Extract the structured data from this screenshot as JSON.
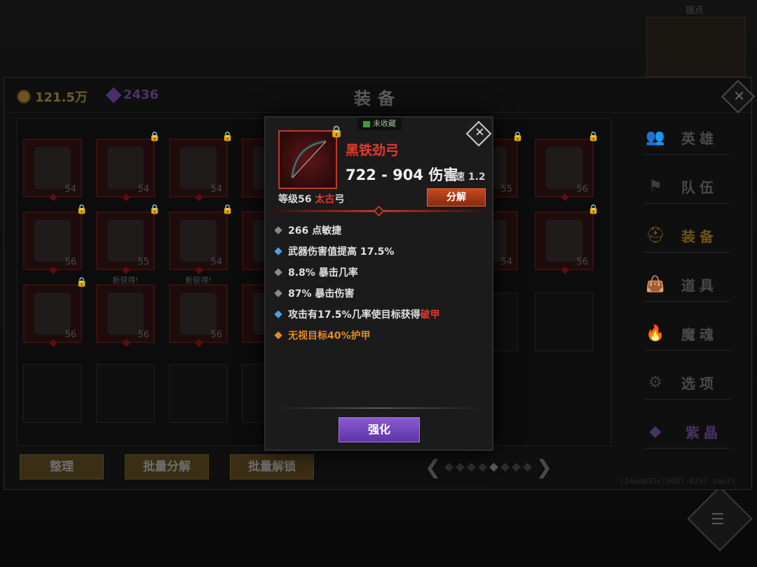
{
  "background": {
    "minimap_label": "据点",
    "menu_icon": "list-icon"
  },
  "panel": {
    "title": "装备",
    "gold": "121.5万",
    "gems": "2436",
    "close_icon": "close-icon"
  },
  "inventory": {
    "row1": [
      {
        "level": "54",
        "locked": false
      },
      {
        "level": "54",
        "locked": true
      },
      {
        "level": "54",
        "locked": true
      },
      {
        "level": "",
        "locked": true
      },
      {
        "level": "55",
        "locked": true
      },
      {
        "level": "56",
        "locked": true
      }
    ],
    "row2": [
      {
        "level": "56",
        "locked": true
      },
      {
        "level": "55",
        "locked": true
      },
      {
        "level": "54",
        "locked": true
      },
      {
        "level": "",
        "locked": true
      },
      {
        "level": "54",
        "locked": false
      },
      {
        "level": "56",
        "locked": true
      }
    ],
    "row3": [
      {
        "level": "56",
        "locked": true,
        "new": ""
      },
      {
        "level": "56",
        "locked": false,
        "new": "新获得!"
      },
      {
        "level": "56",
        "locked": false,
        "new": "新获得!"
      },
      {
        "level": "",
        "locked": false,
        "new": "新"
      }
    ]
  },
  "bottom_buttons": {
    "sort": "整理",
    "batch_decompose": "批量分解",
    "batch_unlock": "批量解锁"
  },
  "pager": {
    "pages": 8,
    "active": 4
  },
  "uid": "[24ed037e|0087-8257-9ae2]",
  "side_nav": [
    {
      "label": "英雄",
      "icon": "heroes-icon",
      "glyph": "👥"
    },
    {
      "label": "队伍",
      "icon": "flag-icon",
      "glyph": "⚑"
    },
    {
      "label": "装备",
      "icon": "helmet-icon",
      "glyph": "⛑"
    },
    {
      "label": "道具",
      "icon": "bag-icon",
      "glyph": "👜"
    },
    {
      "label": "魔魂",
      "icon": "flame-icon",
      "glyph": "🔥"
    },
    {
      "label": "选项",
      "icon": "gear-icon",
      "glyph": "⚙"
    },
    {
      "label": "紫晶",
      "icon": "amethyst-icon",
      "glyph": "◆"
    }
  ],
  "popup": {
    "collect_tag": "未收藏",
    "item_name": "黑铁劲弓",
    "damage": "722 - 904 伤害",
    "speed": "攻速 1.2",
    "level_prefix": "等级56",
    "rarity": "太古",
    "item_type": "弓",
    "decompose": "分解",
    "stats": [
      {
        "bullet": "gray",
        "text": "266 点敏捷"
      },
      {
        "bullet": "blue",
        "text": "武器伤害值提高 17.5%"
      },
      {
        "bullet": "gray",
        "text": "8.8% 暴击几率"
      },
      {
        "bullet": "gray",
        "text": "87% 暴击伤害"
      },
      {
        "bullet": "blue",
        "text": "攻击有17.5%几率使目标获得",
        "highlight": "破甲"
      },
      {
        "bullet": "orange",
        "text": "无视目标40%护甲"
      }
    ],
    "enhance": "强化"
  },
  "colors": {
    "rarity_red": "#e33a2c",
    "enhance_purple": "#7a4ac0",
    "decompose_orange": "#c44a20",
    "legendary_orange": "#e08a2a",
    "magic_blue": "#4aa3e8"
  }
}
